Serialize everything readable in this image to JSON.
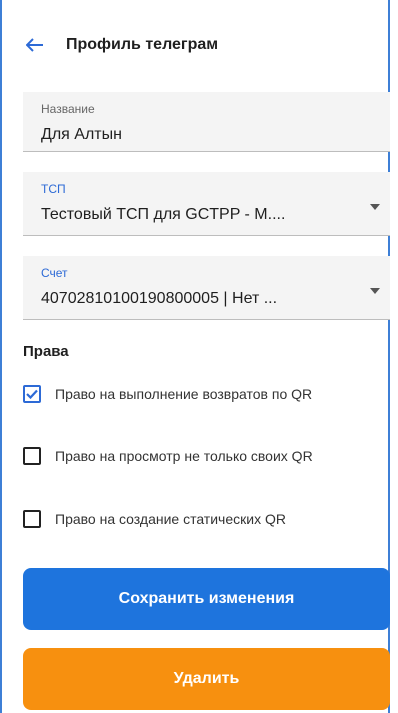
{
  "header": {
    "title": "Профиль телеграм"
  },
  "fields": {
    "name": {
      "label": "Название",
      "value": "Для Алтын"
    },
    "tsp": {
      "label": "ТСП",
      "value": "Тестовый ТСП для GCTPP - М...."
    },
    "account": {
      "label": "Счет",
      "value": "40702810100190800005 | Нет ..."
    }
  },
  "rights": {
    "title": "Права",
    "items": [
      {
        "label": "Право на выполнение возвратов по QR",
        "checked": true
      },
      {
        "label": "Право на просмотр не только своих QR",
        "checked": false
      },
      {
        "label": "Право на создание статических QR",
        "checked": false
      }
    ]
  },
  "buttons": {
    "save": "Сохранить изменения",
    "delete": "Удалить"
  },
  "colors": {
    "primary": "#1e74dd",
    "danger": "#f7900f",
    "accent_label": "#2d6ad6"
  }
}
